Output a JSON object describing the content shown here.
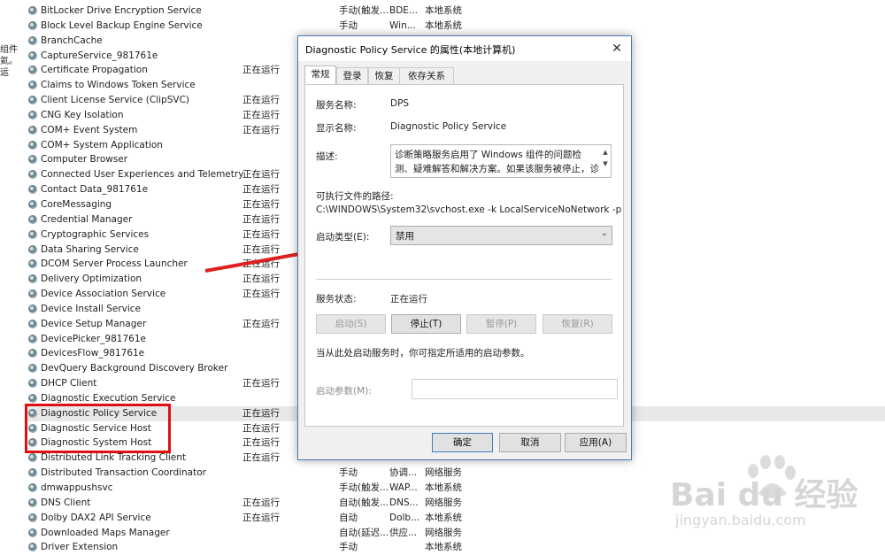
{
  "left_strip": [
    "组件",
    "氦。",
    "运"
  ],
  "services": [
    {
      "name": "BitLocker Drive Encryption Service",
      "status": "",
      "startup": "手动(触发...",
      "logon": "BDE...",
      "account": "本地系统"
    },
    {
      "name": "Block Level Backup Engine Service",
      "status": "",
      "startup": "手动",
      "logon": "Win...",
      "account": "本地系统"
    },
    {
      "name": "BranchCache",
      "status": "",
      "startup": "",
      "logon": "",
      "account": ""
    },
    {
      "name": "CaptureService_981761e",
      "status": "",
      "startup": "",
      "logon": "",
      "account": ""
    },
    {
      "name": "Certificate Propagation",
      "status": "正在运行",
      "startup": "",
      "logon": "",
      "account": ""
    },
    {
      "name": "Claims to Windows Token Service",
      "status": "",
      "startup": "",
      "logon": "",
      "account": ""
    },
    {
      "name": "Client License Service (ClipSVC)",
      "status": "正在运行",
      "startup": "",
      "logon": "",
      "account": ""
    },
    {
      "name": "CNG Key Isolation",
      "status": "正在运行",
      "startup": "",
      "logon": "",
      "account": ""
    },
    {
      "name": "COM+ Event System",
      "status": "正在运行",
      "startup": "",
      "logon": "",
      "account": ""
    },
    {
      "name": "COM+ System Application",
      "status": "",
      "startup": "",
      "logon": "",
      "account": ""
    },
    {
      "name": "Computer Browser",
      "status": "",
      "startup": "",
      "logon": "",
      "account": ""
    },
    {
      "name": "Connected User Experiences and Telemetry",
      "status": "正在运行",
      "startup": "",
      "logon": "",
      "account": ""
    },
    {
      "name": "Contact Data_981761e",
      "status": "正在运行",
      "startup": "",
      "logon": "",
      "account": ""
    },
    {
      "name": "CoreMessaging",
      "status": "正在运行",
      "startup": "",
      "logon": "",
      "account": ""
    },
    {
      "name": "Credential Manager",
      "status": "正在运行",
      "startup": "",
      "logon": "",
      "account": ""
    },
    {
      "name": "Cryptographic Services",
      "status": "正在运行",
      "startup": "",
      "logon": "",
      "account": ""
    },
    {
      "name": "Data Sharing Service",
      "status": "正在运行",
      "startup": "",
      "logon": "",
      "account": ""
    },
    {
      "name": "DCOM Server Process Launcher",
      "status": "正在运行",
      "startup": "",
      "logon": "",
      "account": ""
    },
    {
      "name": "Delivery Optimization",
      "status": "正在运行",
      "startup": "",
      "logon": "",
      "account": ""
    },
    {
      "name": "Device Association Service",
      "status": "正在运行",
      "startup": "",
      "logon": "",
      "account": ""
    },
    {
      "name": "Device Install Service",
      "status": "",
      "startup": "",
      "logon": "",
      "account": ""
    },
    {
      "name": "Device Setup Manager",
      "status": "正在运行",
      "startup": "",
      "logon": "",
      "account": ""
    },
    {
      "name": "DevicePicker_981761e",
      "status": "",
      "startup": "",
      "logon": "",
      "account": ""
    },
    {
      "name": "DevicesFlow_981761e",
      "status": "",
      "startup": "",
      "logon": "",
      "account": ""
    },
    {
      "name": "DevQuery Background Discovery Broker",
      "status": "",
      "startup": "",
      "logon": "",
      "account": ""
    },
    {
      "name": "DHCP Client",
      "status": "正在运行",
      "startup": "",
      "logon": "",
      "account": ""
    },
    {
      "name": "Diagnostic Execution Service",
      "status": "",
      "startup": "",
      "logon": "",
      "account": ""
    },
    {
      "name": "Diagnostic Policy Service",
      "status": "正在运行",
      "startup": "",
      "logon": "",
      "account": ""
    },
    {
      "name": "Diagnostic Service Host",
      "status": "正在运行",
      "startup": "",
      "logon": "",
      "account": ""
    },
    {
      "name": "Diagnostic System Host",
      "status": "正在运行",
      "startup": "",
      "logon": "",
      "account": ""
    },
    {
      "name": "Distributed Link Tracking Client",
      "status": "正在运行",
      "startup": "",
      "logon": "",
      "account": ""
    },
    {
      "name": "Distributed Transaction Coordinator",
      "status": "",
      "startup": "手动",
      "logon": "协调...",
      "account": "网络服务"
    },
    {
      "name": "dmwappushsvc",
      "status": "",
      "startup": "手动(触发...",
      "logon": "WAP...",
      "account": "本地系统"
    },
    {
      "name": "DNS Client",
      "status": "正在运行",
      "startup": "自动(触发...",
      "logon": "DNS...",
      "account": "网络服务"
    },
    {
      "name": "Dolby DAX2 API Service",
      "status": "正在运行",
      "startup": "自动",
      "logon": "Dolb...",
      "account": "本地系统"
    },
    {
      "name": "Downloaded Maps Manager",
      "status": "",
      "startup": "自动(延迟...",
      "logon": "供应...",
      "account": "网络服务"
    },
    {
      "name": "Driver Extension",
      "status": "",
      "startup": "手动",
      "logon": "",
      "account": "本地系统"
    }
  ],
  "dialog": {
    "title": "Diagnostic Policy Service 的属性(本地计算机)",
    "tabs": [
      "常规",
      "登录",
      "恢复",
      "依存关系"
    ],
    "service_name_label": "服务名称:",
    "service_name": "DPS",
    "display_name_label": "显示名称:",
    "display_name": "Diagnostic Policy Service",
    "description_label": "描述:",
    "description": "诊断策略服务启用了 Windows 组件的问题检测、疑难解答和解决方案。如果该服务被停止，诊断将不再运",
    "exe_path_label": "可执行文件的路径:",
    "exe_path": "C:\\WINDOWS\\System32\\svchost.exe -k LocalServiceNoNetwork -p",
    "startup_type_label": "启动类型(E):",
    "startup_type": "禁用",
    "status_label": "服务状态:",
    "status": "正在运行",
    "btn_start": "启动(S)",
    "btn_stop": "停止(T)",
    "btn_pause": "暂停(P)",
    "btn_resume": "恢复(R)",
    "hint": "当从此处启动服务时，你可指定所适用的启动参数。",
    "param_label": "启动参数(M):",
    "param_value": "",
    "btn_ok": "确定",
    "btn_cancel": "取消",
    "btn_apply": "应用(A)"
  },
  "watermark": {
    "brand": "Bai du 经验",
    "url": "jingyan.baidu.com"
  },
  "colors": {
    "highlight_box": "#e01010",
    "arrow": "#e02020",
    "dialog_border": "#4a7ab5",
    "selected_row": "#e8e8e8"
  }
}
